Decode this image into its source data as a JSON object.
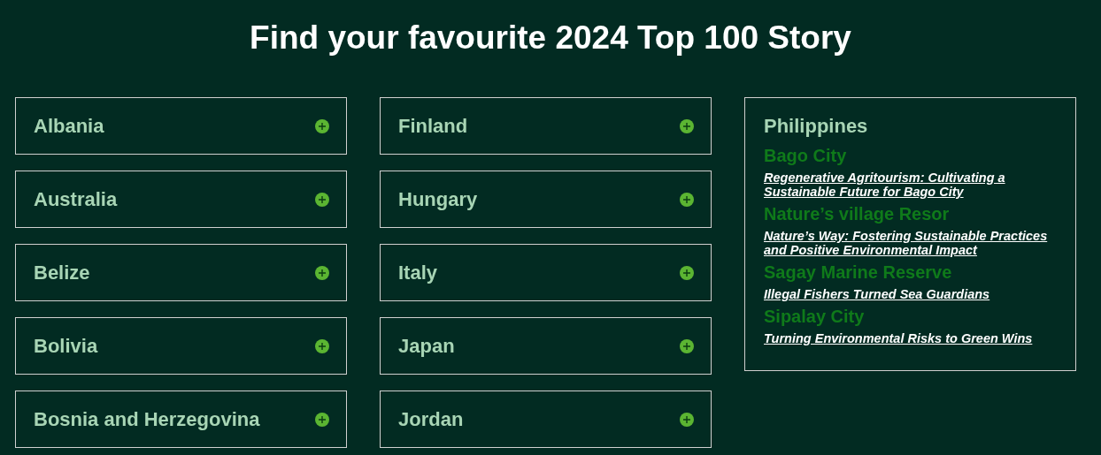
{
  "title": "Find your favourite 2024 Top 100 Story",
  "columns": [
    {
      "countries": [
        {
          "name": "Albania",
          "expanded": false
        },
        {
          "name": "Australia",
          "expanded": false
        },
        {
          "name": "Belize",
          "expanded": false
        },
        {
          "name": "Bolivia",
          "expanded": false
        },
        {
          "name": "Bosnia and Herzegovina",
          "expanded": false
        }
      ]
    },
    {
      "countries": [
        {
          "name": "Finland",
          "expanded": false
        },
        {
          "name": "Hungary",
          "expanded": false
        },
        {
          "name": "Italy",
          "expanded": false
        },
        {
          "name": "Japan",
          "expanded": false
        },
        {
          "name": "Jordan",
          "expanded": false
        }
      ]
    },
    {
      "countries": [
        {
          "name": "Philippines",
          "expanded": true,
          "places": [
            {
              "name": "Bago City",
              "stories": [
                "Regenerative Agritourism: Cultivating a Sustainable Future for Bago City"
              ]
            },
            {
              "name": "Nature’s village Resor",
              "stories": [
                "Nature’s Way: Fostering Sustainable Practices and Positive Environmental Impact"
              ]
            },
            {
              "name": "Sagay Marine Reserve",
              "stories": [
                "Illegal Fishers Turned Sea Guardians"
              ]
            },
            {
              "name": "Sipalay City",
              "stories": [
                "Turning Environmental Risks to Green Wins"
              ]
            }
          ]
        }
      ]
    }
  ]
}
